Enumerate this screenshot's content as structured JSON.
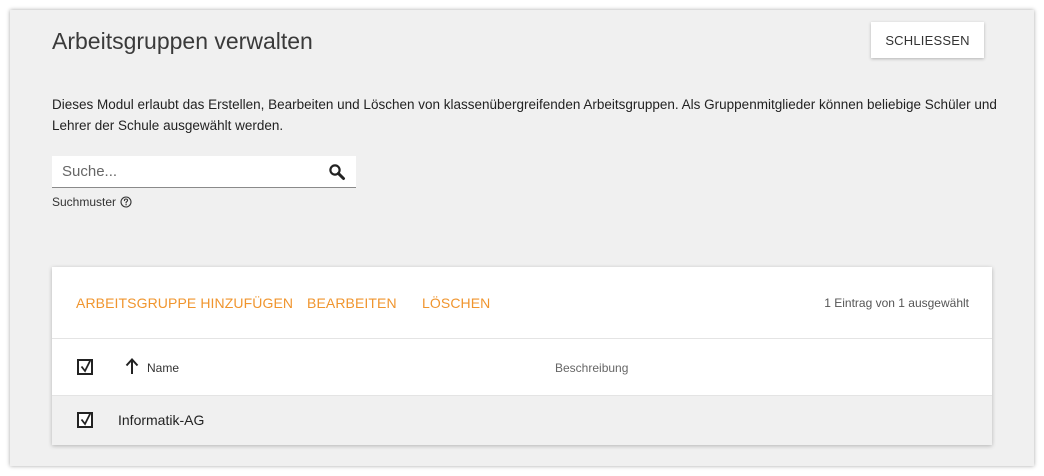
{
  "header": {
    "title": "Arbeitsgruppen verwalten",
    "close_label": "SCHLIESSEN"
  },
  "description": "Dieses Modul erlaubt das Erstellen, Bearbeiten und Löschen von klassenübergreifenden Arbeitsgruppen. Als Gruppenmitglieder können beliebige Schüler und Lehrer der Schule ausgewählt werden.",
  "search": {
    "placeholder": "Suche...",
    "pattern_label": "Suchmuster"
  },
  "toolbar": {
    "add_label": "ARBEITSGRUPPE HINZUFÜGEN",
    "edit_label": "BEARBEITEN",
    "delete_label": "LÖSCHEN",
    "selection_status": "1 Eintrag von 1 ausgewählt"
  },
  "table": {
    "columns": [
      {
        "label": "Name",
        "sorted": "ascending"
      },
      {
        "label": "Beschreibung"
      }
    ],
    "rows": [
      {
        "name": "Informatik-AG",
        "description": "",
        "selected": true
      }
    ],
    "header_checkbox_checked": true
  },
  "colors": {
    "accent": "#f0952e",
    "module_background": "#f0f0f0",
    "card_background": "#ffffff"
  }
}
